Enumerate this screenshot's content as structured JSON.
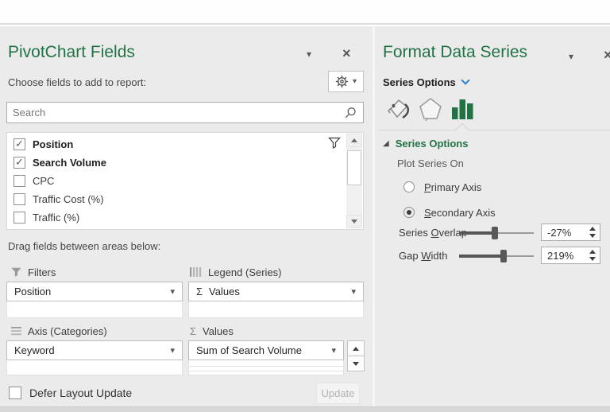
{
  "pivot_panel": {
    "title": "PivotChart Fields",
    "choose_label": "Choose fields to add to report:",
    "search_placeholder": "Search",
    "fields": [
      {
        "label": "Position",
        "checked": true
      },
      {
        "label": "Search Volume",
        "checked": true
      },
      {
        "label": "CPC",
        "checked": false
      },
      {
        "label": "Traffic Cost (%)",
        "checked": false
      },
      {
        "label": "Traffic (%)",
        "checked": false
      }
    ],
    "drag_label": "Drag fields between areas below:",
    "areas": [
      {
        "title": "Filters",
        "chip": "Position"
      },
      {
        "title": "Legend (Series)",
        "chip": "Values",
        "chip_sigma": true
      },
      {
        "title": "Axis (Categories)",
        "chip": "Keyword"
      },
      {
        "title": "Values",
        "chip": "Sum of Search Volume"
      }
    ],
    "defer_label": "Defer Layout Update",
    "defer_checked": false,
    "update_label": "Update"
  },
  "format_panel": {
    "title": "Format Data Series",
    "nav_label": "Series Options",
    "tabs": [
      "fill-line",
      "effects",
      "series-options"
    ],
    "active_tab": "series-options",
    "section_title": "Series Options",
    "plot_series_label": "Plot Series On",
    "radios": [
      {
        "label": "Primary Axis",
        "accel_index": 0,
        "selected": false
      },
      {
        "label": "Secondary Axis",
        "accel_index": 0,
        "selected": true
      }
    ],
    "sliders": [
      {
        "label": "Series Overlap",
        "accel_index": 7,
        "value": "-27%",
        "position_pct": 48
      },
      {
        "label": "Gap Width",
        "accel_index": 4,
        "value": "219%",
        "position_pct": 60
      }
    ]
  },
  "colors": {
    "excel_green": "#217346",
    "chevron_blue": "#2e83c6"
  }
}
